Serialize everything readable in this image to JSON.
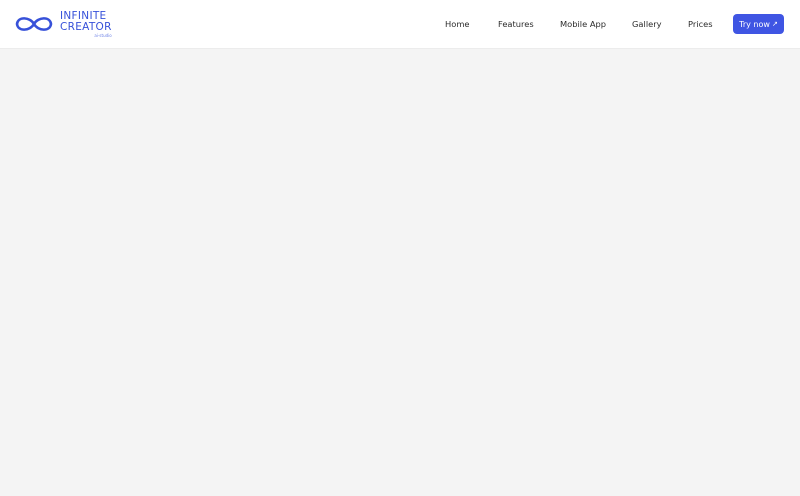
{
  "brand": {
    "line1": "INFINITE",
    "line2": "CREATOR",
    "tag": "ai-studio",
    "icon": "infinity-icon",
    "color": "#3751d9"
  },
  "nav": {
    "items": [
      {
        "label": "Home"
      },
      {
        "label": "Features"
      },
      {
        "label": "Mobile App"
      },
      {
        "label": "Gallery"
      },
      {
        "label": "Prices"
      }
    ],
    "cta": {
      "label": "Try now",
      "icon": "arrow-up-right-icon",
      "arrow": "↗",
      "color": "#3f55e3"
    }
  }
}
